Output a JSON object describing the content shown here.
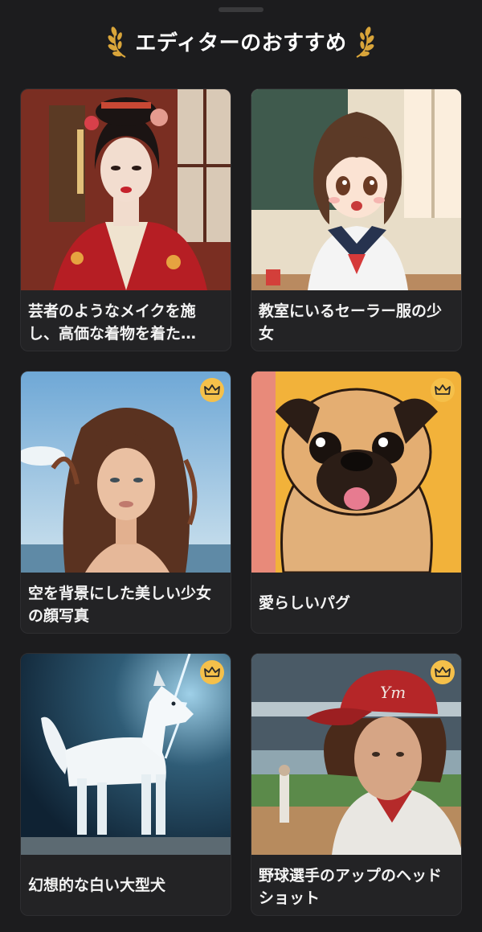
{
  "header": {
    "title": "エディターのおすすめ",
    "accent_color": "#d9a53a"
  },
  "cards": [
    {
      "caption": "芸者のようなメイクを施し、高価な着物を着た…",
      "premium": false
    },
    {
      "caption": "教室にいるセーラー服の少女",
      "premium": false
    },
    {
      "caption": "空を背景にした美しい少女の顔写真",
      "premium": true
    },
    {
      "caption": "愛らしいパグ",
      "premium": true
    },
    {
      "caption": "幻想的な白い大型犬",
      "premium": true
    },
    {
      "caption": "野球選手のアップのヘッドショット",
      "premium": true
    }
  ],
  "icons": {
    "premium": "crown-icon",
    "header_decoration": "laurel-icon"
  },
  "colors": {
    "background": "#1c1c1e",
    "card": "#232325",
    "crown_badge": "#f5c04a"
  }
}
